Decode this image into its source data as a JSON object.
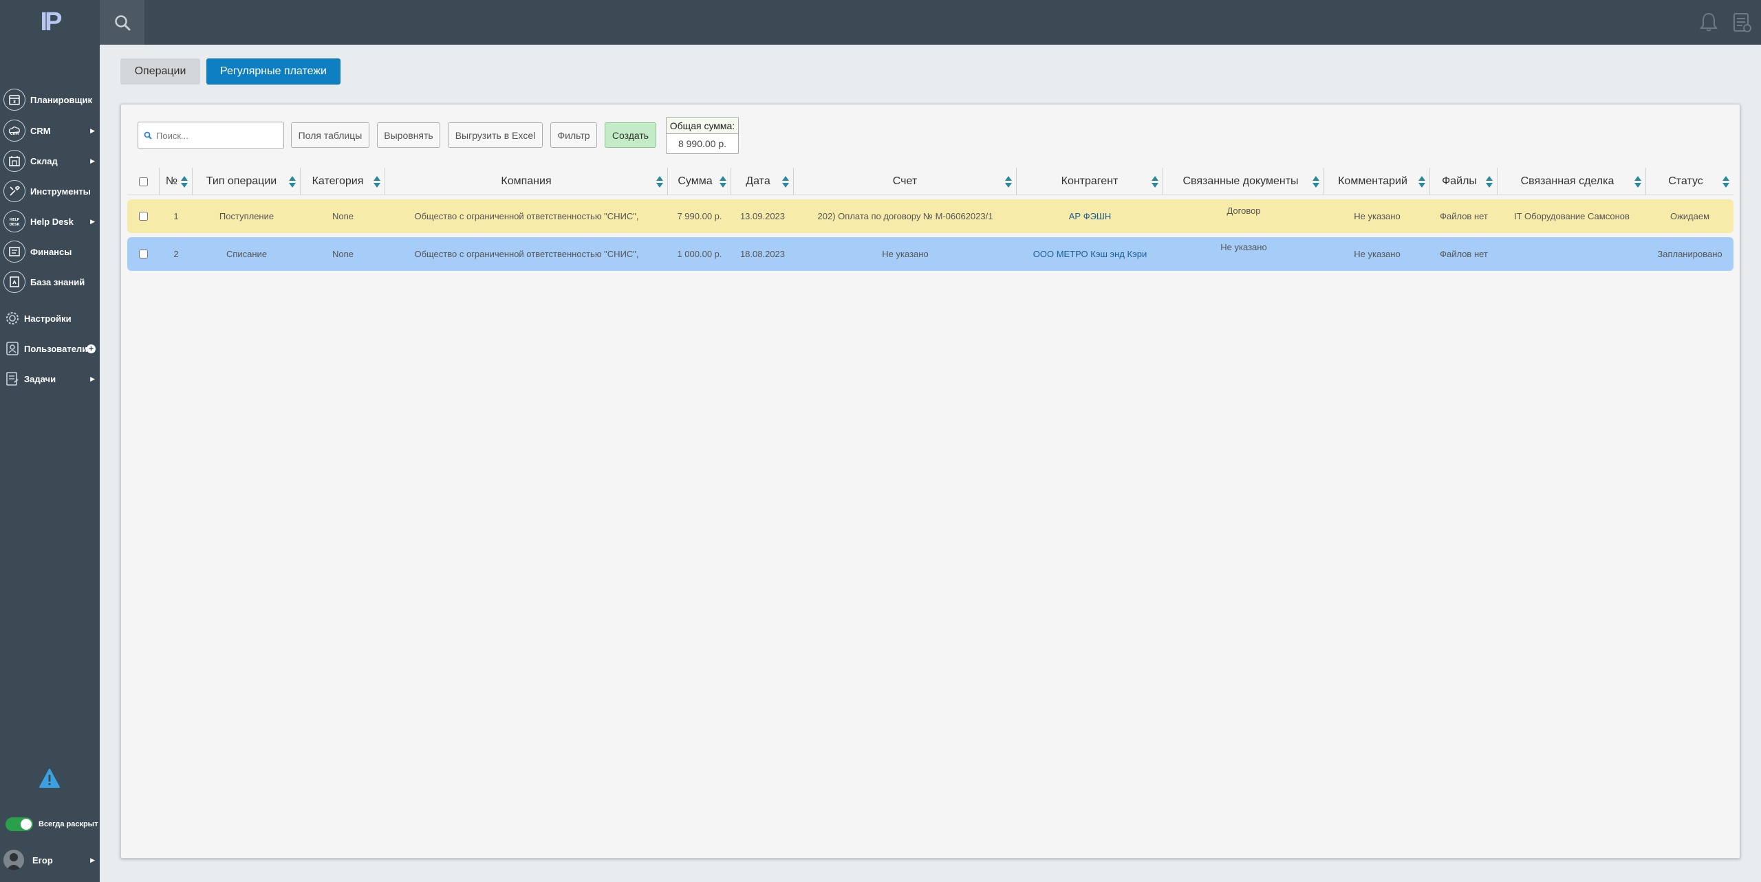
{
  "app": {
    "logo": "IP"
  },
  "sidebar": {
    "items": [
      {
        "label": "Планировщик",
        "icon": "calendar-icon",
        "arrow": false
      },
      {
        "label": "CRM",
        "icon": "crm-icon",
        "arrow": true
      },
      {
        "label": "Склад",
        "icon": "warehouse-icon",
        "arrow": true
      },
      {
        "label": "Инструменты",
        "icon": "tools-icon",
        "arrow": false
      },
      {
        "label": "Help Desk",
        "icon": "helpdesk-icon",
        "arrow": true
      },
      {
        "label": "Финансы",
        "icon": "finance-icon",
        "arrow": false
      },
      {
        "label": "База знаний",
        "icon": "knowledge-icon",
        "arrow": false
      },
      {
        "label": "Настройки",
        "icon": "gear-icon",
        "arrow": false
      },
      {
        "label": "Пользователи",
        "icon": "users-icon",
        "plus": true
      },
      {
        "label": "Задачи",
        "icon": "tasks-icon",
        "arrow": true
      }
    ],
    "toggle_label": "Всегда раскрыт",
    "user_name": "Егор"
  },
  "tabs": {
    "operations": "Операции",
    "regular": "Регулярные платежи"
  },
  "toolbar": {
    "search_placeholder": "Поиск...",
    "fields_btn": "Поля таблицы",
    "align_btn": "Выровнять",
    "excel_btn": "Выгрузить в Excel",
    "filter_btn": "Фильтр",
    "create_btn": "Создать",
    "total_label": "Общая сумма:",
    "total_value": "8 990.00 р."
  },
  "table": {
    "headers": {
      "num": "№",
      "type": "Тип операции",
      "category": "Категория",
      "company": "Компания",
      "sum": "Сумма",
      "date": "Дата",
      "account": "Счет",
      "counterparty": "Контрагент",
      "docs": "Связанные документы",
      "comment": "Комментарий",
      "files": "Файлы",
      "deal": "Связанная сделка",
      "status": "Статус"
    },
    "rows": [
      {
        "num": "1",
        "type": "Поступление",
        "category": "None",
        "company": "Общество с ограниченной ответственностью \"СНИС\",",
        "sum": "7 990.00 р.",
        "date": "13.09.2023",
        "account": "202) Оплата по договору № М-06062023/1",
        "counterparty": "АР ФЭШН",
        "docs": "Договор",
        "comment": "Не указано",
        "files": "Файлов нет",
        "deal": "IT Оборудование Самсонов",
        "status": "Ожидаем"
      },
      {
        "num": "2",
        "type": "Списание",
        "category": "None",
        "company": "Общество с ограниченной ответственностью \"СНИС\",",
        "sum": "1 000.00 р.",
        "date": "18.08.2023",
        "account": "Не указано",
        "counterparty": "ООО МЕТРО Кэш энд Кэри",
        "docs": "Не указано",
        "comment": "Не указано",
        "files": "Файлов нет",
        "deal": "",
        "status": "Запланировано"
      }
    ]
  },
  "colors": {
    "topbar": "#3c4a55",
    "accent": "#0e7fc0",
    "row1": "#f7ebaa",
    "row2": "#a6cdf7",
    "create": "#c3ecc6",
    "sort_arrow": "#2a8a9c"
  }
}
